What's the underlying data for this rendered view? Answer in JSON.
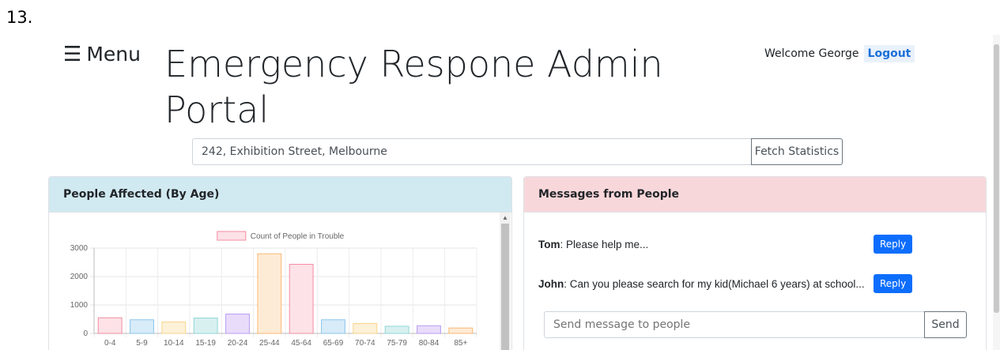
{
  "step_number": "13.",
  "menu": {
    "label": "Menu",
    "icon": "hamburger-icon"
  },
  "header": {
    "title": "Emergency Respone Admin Portal",
    "welcome": "Welcome George",
    "logout_label": "Logout"
  },
  "address": {
    "value": "242, Exhibition Street, Melbourne",
    "fetch_label": "Fetch Statistics"
  },
  "age_card": {
    "title": "People Affected (By Age)"
  },
  "messages_card": {
    "title": "Messages from People",
    "messages": [
      {
        "sender": "Tom",
        "text": ": Please help me..."
      },
      {
        "sender": "John",
        "text": ": Can you please search for my kid(Michael 6 years) at school..."
      }
    ],
    "reply_label": "Reply",
    "send_placeholder": "Send message to people",
    "send_label": "Send"
  },
  "colors": {
    "age_header_bg": "#d1e9f0",
    "messages_header_bg": "#f8d7da",
    "primary": "#0d6efd"
  },
  "chart_data": {
    "type": "bar",
    "categories": [
      "0-4",
      "5-9",
      "10-14",
      "15-19",
      "20-24",
      "25-44",
      "45-64",
      "65-69",
      "70-74",
      "75-79",
      "80-84",
      "85+"
    ],
    "series": [
      {
        "name": "Count of People in Trouble",
        "values": [
          550,
          480,
          400,
          540,
          680,
          2800,
          2430,
          480,
          350,
          250,
          270,
          190
        ]
      }
    ],
    "bar_fill_colors": [
      "#fde2e7",
      "#d7ebf8",
      "#fdf1d8",
      "#d9f0f0",
      "#e9dcfb",
      "#feebd5",
      "#fde2e7",
      "#d7ebf8",
      "#fdf1d8",
      "#d9f0f0",
      "#e9dcfb",
      "#feebd5"
    ],
    "bar_stroke_colors": [
      "#f28ca2",
      "#8cc5ec",
      "#f9d488",
      "#8fd6d6",
      "#b89df2",
      "#f9b873",
      "#f28ca2",
      "#8cc5ec",
      "#f9d488",
      "#8fd6d6",
      "#b89df2",
      "#f9b873"
    ],
    "ylim": [
      0,
      3000
    ],
    "yticks": [
      0,
      1000,
      2000,
      3000
    ],
    "grid": true,
    "legend": "top"
  }
}
